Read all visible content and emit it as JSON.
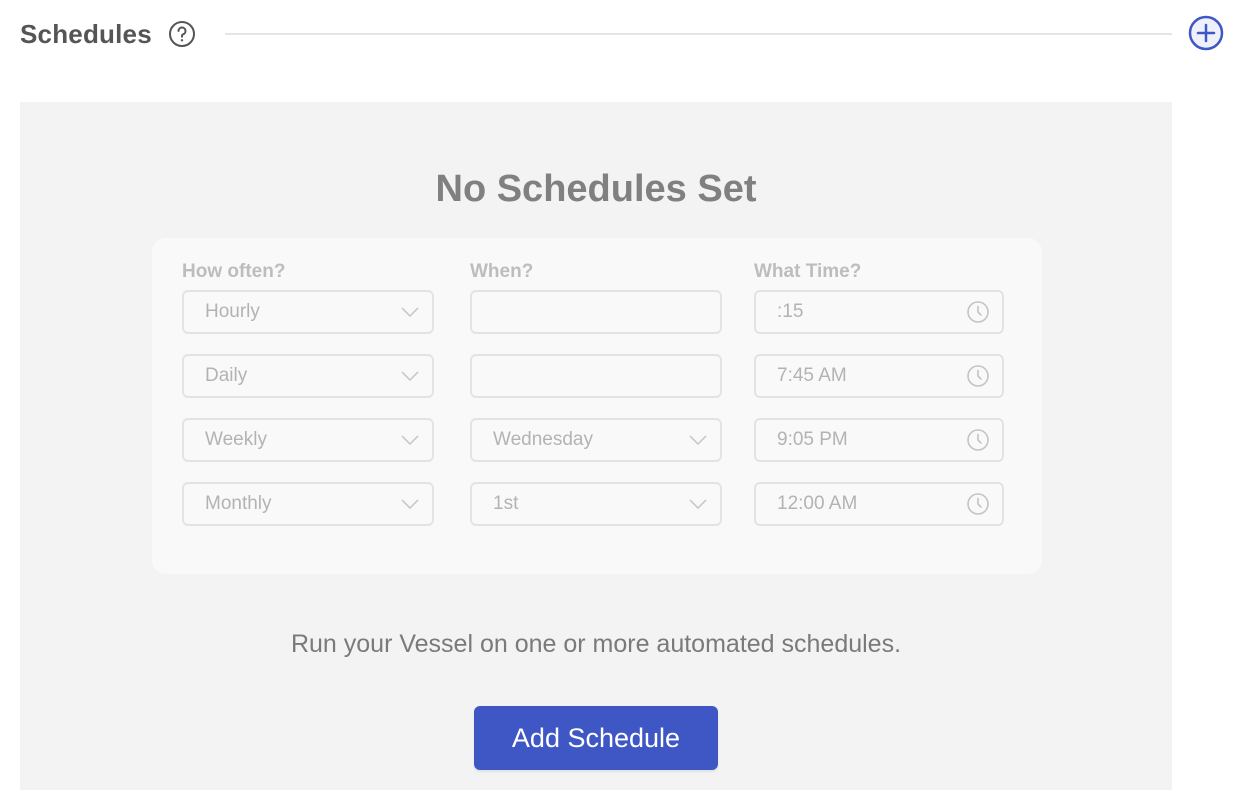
{
  "header": {
    "title": "Schedules",
    "help_icon": "question-circle-icon",
    "add_icon": "plus-circle-icon"
  },
  "empty_state": {
    "title": "No Schedules Set",
    "description": "Run your Vessel on one or more automated schedules.",
    "button_label": "Add Schedule"
  },
  "preview": {
    "columns": [
      "How often?",
      "When?",
      "What Time?"
    ],
    "rows": [
      {
        "frequency": "Hourly",
        "when": "",
        "when_type": "input",
        "time": ":15"
      },
      {
        "frequency": "Daily",
        "when": "",
        "when_type": "input",
        "time": "7:45 AM"
      },
      {
        "frequency": "Weekly",
        "when": "Wednesday",
        "when_type": "select",
        "time": "9:05 PM"
      },
      {
        "frequency": "Monthly",
        "when": "1st",
        "when_type": "select",
        "time": "12:00 AM"
      }
    ]
  },
  "colors": {
    "accent": "#3f57c5",
    "panel_bg": "#f3f3f3",
    "card_bg": "#f9f9f9"
  }
}
